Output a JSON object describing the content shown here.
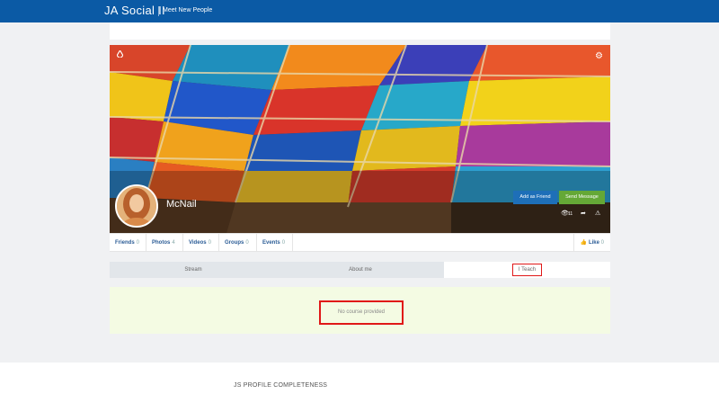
{
  "header": {
    "brand": "JA Social II",
    "tagline": "Meet New People"
  },
  "profile": {
    "name": "McNail",
    "buttons": {
      "add_friend": "Add as Friend",
      "send_message": "Send Message"
    },
    "views": "11"
  },
  "stats": [
    {
      "label": "Friends",
      "count": "0"
    },
    {
      "label": "Photos",
      "count": "4"
    },
    {
      "label": "Videos",
      "count": "0"
    },
    {
      "label": "Groups",
      "count": "0"
    },
    {
      "label": "Events",
      "count": "0"
    }
  ],
  "like": {
    "label": "Like",
    "count": "0"
  },
  "tabs": {
    "stream": "Stream",
    "about": "About me",
    "iteach": "I Teach"
  },
  "panel": {
    "message": "No course provided"
  },
  "footer": {
    "heading": "JS PROFILE COMPLETENESS"
  }
}
